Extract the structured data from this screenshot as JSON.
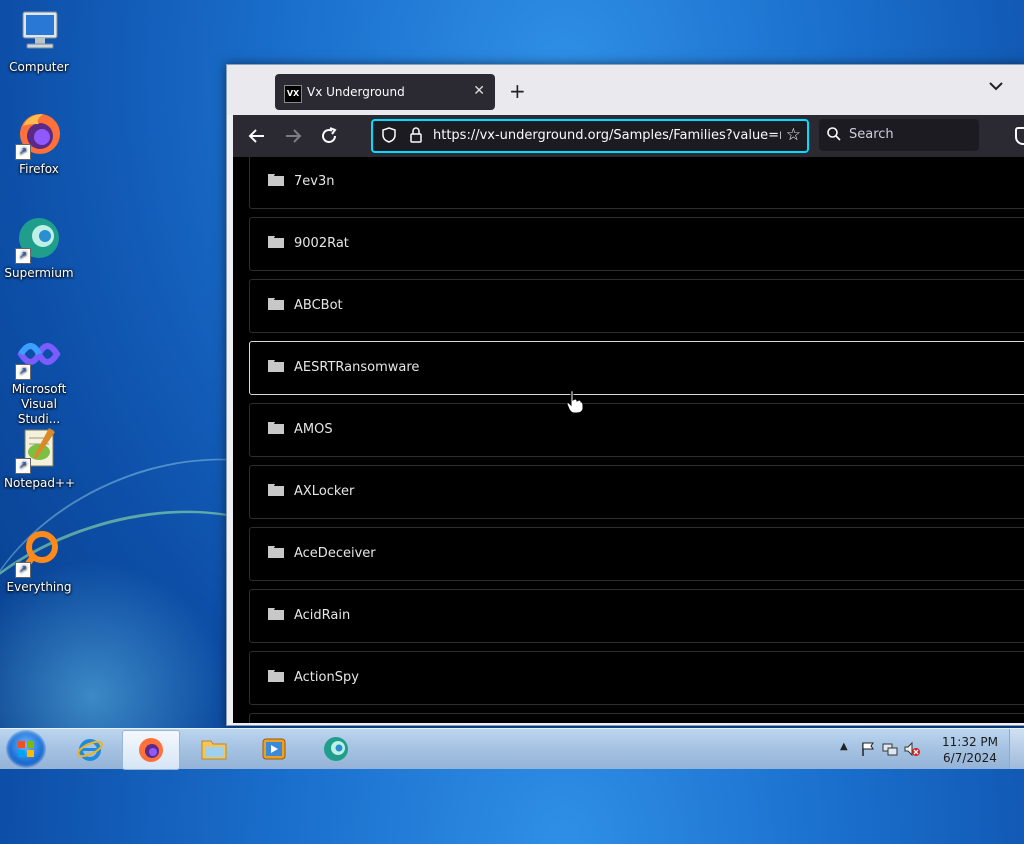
{
  "desktop": {
    "icons": [
      {
        "label": "Computer",
        "icon": "computer-icon"
      },
      {
        "label": "Firefox",
        "icon": "firefox-icon"
      },
      {
        "label": "Supermium",
        "icon": "supermium-icon"
      },
      {
        "label": "Microsoft Visual Studi...",
        "icon": "visual-studio-icon"
      },
      {
        "label": "Notepad++",
        "icon": "notepadpp-icon"
      },
      {
        "label": "Everything",
        "icon": "everything-icon"
      }
    ]
  },
  "browser": {
    "tab": {
      "favicon_text": "VX",
      "title": "Vx Underground"
    },
    "url": "https://vx-underground.org/Samples/Families?value=ransomware",
    "search_placeholder": "Search"
  },
  "families": [
    "7ev3n",
    "9002Rat",
    "ABCBot",
    "AESRTRansomware",
    "AMOS",
    "AXLocker",
    "AceDeceiver",
    "AcidRain",
    "ActionSpy"
  ],
  "taskbar": {
    "clock_time": "11:32 PM",
    "clock_date": "6/7/2024"
  },
  "colors": {
    "url_focus": "#00ddff",
    "toolbar": "#2b2a33",
    "content_bg": "#000000"
  }
}
